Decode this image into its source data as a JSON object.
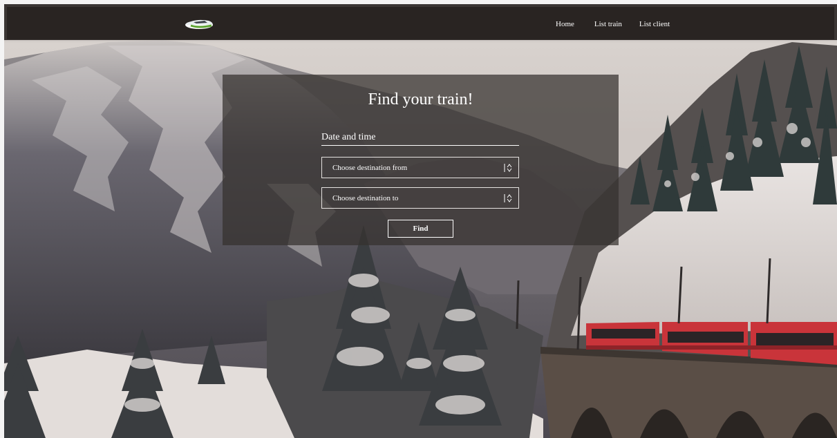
{
  "navbar": {
    "logo_icon": "train-logo-icon",
    "links": [
      {
        "label": "Home"
      },
      {
        "label": "List train"
      },
      {
        "label": "List client"
      }
    ]
  },
  "search_form": {
    "title": "Find your train!",
    "datetime_placeholder": "Date and time",
    "from_select": {
      "selected": "Choose destination from",
      "icon": "select-arrows-icon"
    },
    "to_select": {
      "selected": "Choose destination to",
      "icon": "select-arrows-icon"
    },
    "submit_label": "Find"
  },
  "colors": {
    "navbar_bg": "#262220",
    "panel_bg": "#34302e",
    "text": "#ffffff",
    "train_red": "#c9343a"
  }
}
